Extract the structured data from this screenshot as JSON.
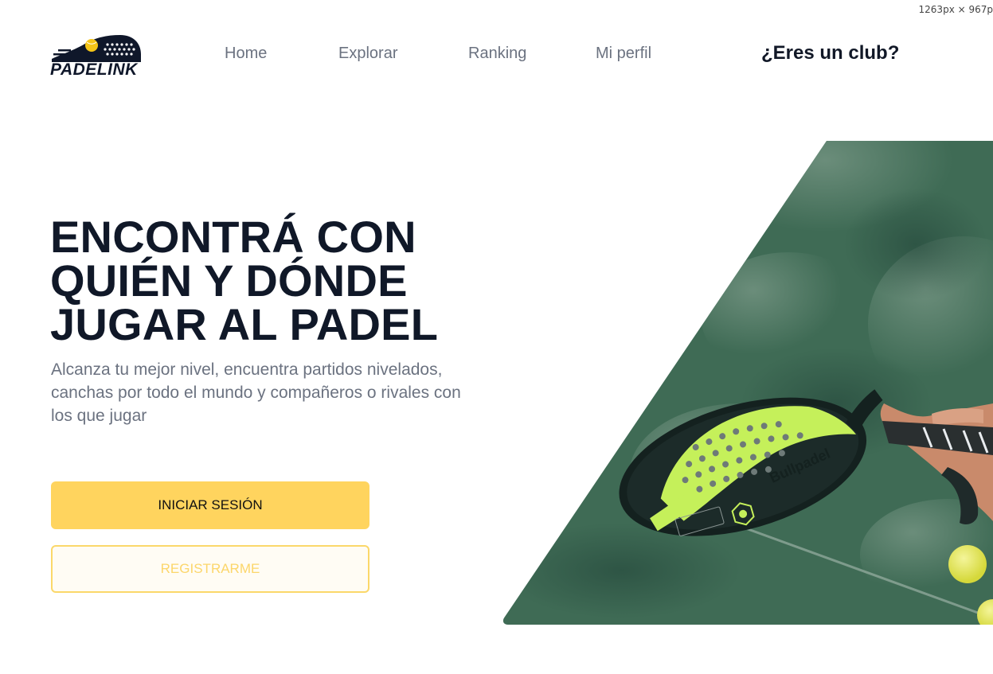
{
  "screen_size_readout": "1263px × 967p",
  "logo": {
    "text": "PADELINK",
    "icon": "padel-racket-ball-icon",
    "colors": {
      "dark": "#0f172a",
      "ball": "#f5c518"
    }
  },
  "nav": {
    "items": [
      {
        "label": "Home"
      },
      {
        "label": "Explorar"
      },
      {
        "label": "Ranking"
      },
      {
        "label": "Mi perfil"
      }
    ],
    "club_link": "¿Eres un club?"
  },
  "hero": {
    "title_lines": [
      "ENCONTRÁ CON",
      "QUIÉN Y DÓNDE",
      "JUGAR AL PADEL"
    ],
    "subtitle": "Alcanza tu mejor nivel, encuentra partidos nivelados, canchas por todo el mundo y compañeros o rivales con los que jugar",
    "image": {
      "subject": "hand holding a padel racket over a green court with tennis balls",
      "racket_brand": "Bullpadel",
      "icon": "padel-racket-photo"
    }
  },
  "buttons": {
    "login": "INICIAR SESIÓN",
    "register": "REGISTRARME"
  },
  "colors": {
    "primary": "#ffd45e",
    "primary_border": "#fbd86a",
    "text_dark": "#101828",
    "text_muted": "#6b7280",
    "court_green": "#3f6b55"
  }
}
